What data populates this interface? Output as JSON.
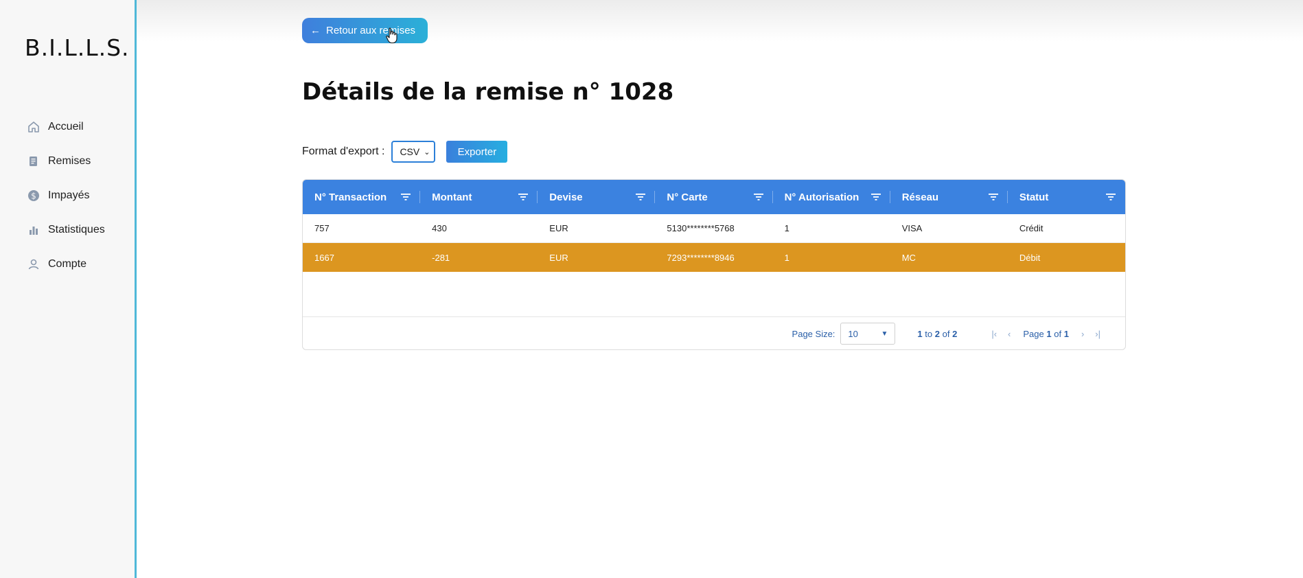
{
  "sidebar": {
    "logo": "B.I.L.L.S.",
    "items": [
      {
        "label": "Accueil",
        "icon": "home-icon"
      },
      {
        "label": "Remises",
        "icon": "receipt-icon"
      },
      {
        "label": "Impayés",
        "icon": "dollar-icon"
      },
      {
        "label": "Statistiques",
        "icon": "bar-chart-icon"
      },
      {
        "label": "Compte",
        "icon": "user-icon"
      }
    ]
  },
  "header": {
    "back_label": "Retour aux remises",
    "title": "Détails de la remise n° 1028"
  },
  "export": {
    "label": "Format d'export :",
    "format": "CSV",
    "button_label": "Exporter"
  },
  "table": {
    "columns": [
      "N° Transaction",
      "Montant",
      "Devise",
      "N° Carte",
      "N° Autorisation",
      "Réseau",
      "Statut"
    ],
    "rows": [
      [
        "757",
        "430",
        "EUR",
        "5130********5768",
        "1",
        "VISA",
        "Crédit"
      ],
      [
        "1667",
        "-281",
        "EUR",
        "7293********8946",
        "1",
        "MC",
        "Débit"
      ]
    ],
    "selected_row": 1,
    "header_color": "#3b82e0",
    "selected_color": "#dc9620"
  },
  "pagination": {
    "page_size_label": "Page Size:",
    "page_size": "10",
    "range_from": "1",
    "range_to": "2",
    "range_total": "2",
    "range_text_to": "to",
    "range_text_of": "of",
    "page_label": "Page",
    "page_current": "1",
    "page_of": "of",
    "page_total": "1"
  },
  "colors": {
    "accent": "#3b82e0",
    "sidebar_border": "#4fb8d8"
  }
}
